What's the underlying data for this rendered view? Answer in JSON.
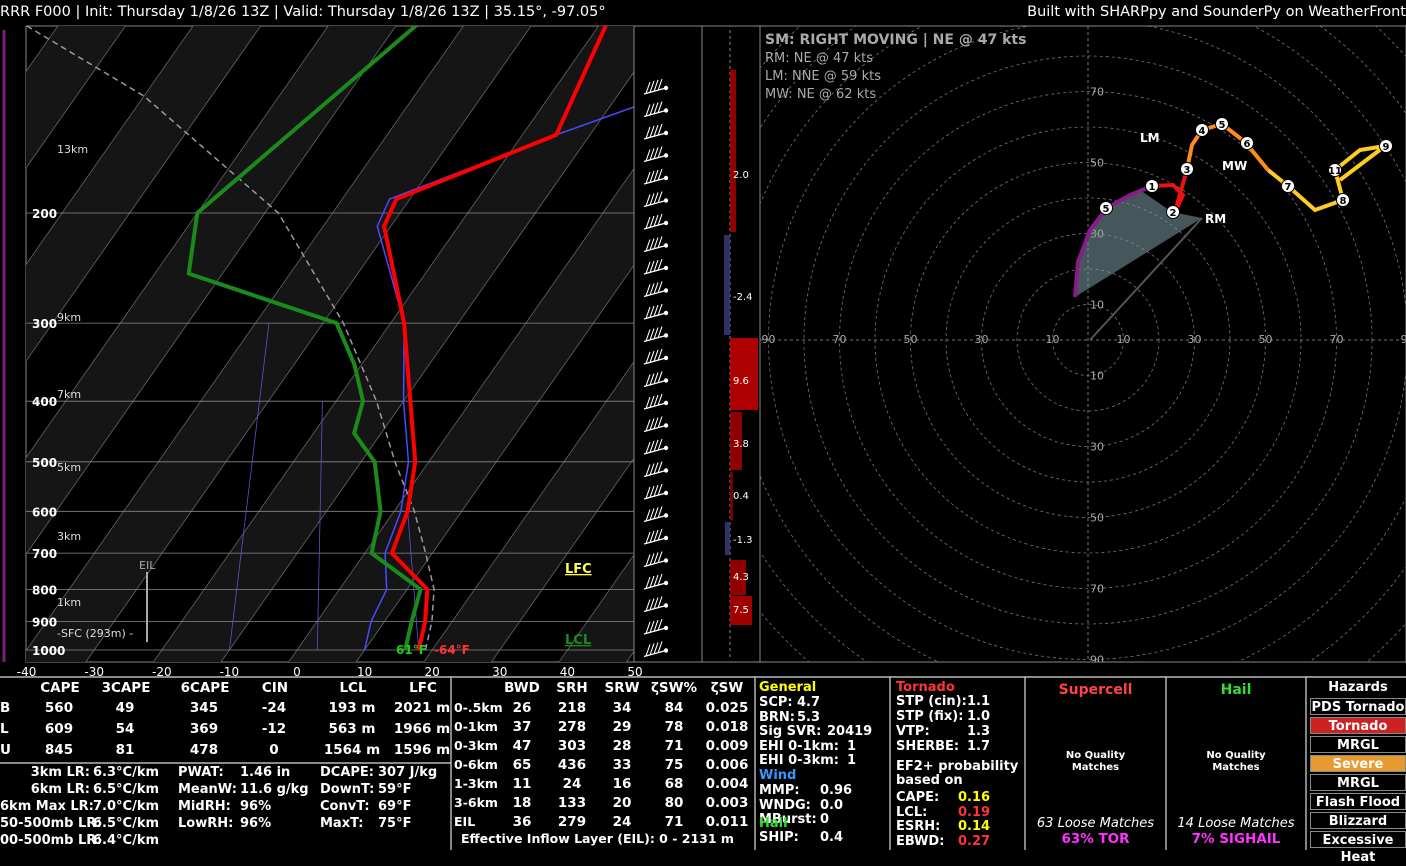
{
  "header": {
    "left": "RRR F000 | Init: Thursday 1/8/26 13Z | Valid: Thursday 1/8/26 13Z | 35.15°, -97.05°",
    "right": "Built with SHARPpy and SounderPy on WeatherFront"
  },
  "colors": {
    "temp": "#ff0000",
    "dew": "#1a8a1a",
    "parcel": "#999999",
    "virtual": "#4a4aff",
    "storm_text": "#aaaaaa"
  },
  "chart_data": [
    {
      "type": "line",
      "title": "Skew-T",
      "x_ticks": [
        "-40",
        "-30",
        "-20",
        "-10",
        "0",
        "10",
        "20",
        "30",
        "40",
        "50"
      ],
      "pressure_ticks": [
        "200",
        "300",
        "400",
        "500",
        "600",
        "700",
        "800",
        "900",
        "1000"
      ],
      "height_labels": [
        "13km",
        "9km",
        "7km",
        "5km",
        "3km",
        "1km",
        "-SFC (293m) -"
      ],
      "series": [
        {
          "name": "temperature",
          "points": [
            [
              -19,
              100
            ],
            [
              -15,
              150
            ],
            [
              -32,
              190
            ],
            [
              -31,
              210
            ],
            [
              -18,
              300
            ],
            [
              -9,
              400
            ],
            [
              -2,
              500
            ],
            [
              2,
              600
            ],
            [
              4,
              700
            ],
            [
              13,
              800
            ],
            [
              16,
              900
            ],
            [
              18,
              1000
            ]
          ]
        },
        {
          "name": "dewpoint",
          "points": [
            [
              -47,
              100
            ],
            [
              -60,
              200
            ],
            [
              -55,
              250
            ],
            [
              -28,
              300
            ],
            [
              -21,
              350
            ],
            [
              -16,
              400
            ],
            [
              -14,
              450
            ],
            [
              -8,
              500
            ],
            [
              -2,
              600
            ],
            [
              1,
              700
            ],
            [
              12,
              800
            ],
            [
              14,
              900
            ],
            [
              16,
              1000
            ]
          ]
        }
      ],
      "surface_temp": "-64°F",
      "surface_dew": "61°F",
      "annotations": [
        "LFC",
        "LCL",
        "EIL"
      ]
    },
    {
      "type": "bar",
      "title": "SRW",
      "labels": [
        "2.0",
        "-2.4",
        "9.6",
        "3.8",
        "0.4",
        "-1.3",
        "4.3",
        "7.5"
      ]
    },
    {
      "type": "line",
      "title": "Hodograph",
      "ring_labels": [
        "10",
        "30",
        "50",
        "70",
        "90"
      ],
      "height_markers": [
        "1",
        "2",
        "3",
        "4",
        "5",
        "6",
        "7",
        "8",
        "9",
        "11",
        "5"
      ],
      "vectors": [
        "RM",
        "LM",
        "MW"
      ],
      "storm_motion": {
        "sm": "SM: RIGHT MOVING | NE @ 47 kts",
        "rm": "RM: NE @ 47 kts",
        "lm": "LM: NNE @ 59 kts",
        "mw": "MW: NE @ 62 kts"
      }
    }
  ],
  "thermo_table": {
    "headers": [
      "CAPE",
      "3CAPE",
      "6CAPE",
      "CIN",
      "LCL",
      "LFC"
    ],
    "rows": [
      [
        "B",
        "560",
        "49",
        "345",
        "-24",
        "193 m",
        "2021 m"
      ],
      [
        "L",
        "609",
        "54",
        "369",
        "-12",
        "563 m",
        "1966 m"
      ],
      [
        "U",
        "845",
        "81",
        "478",
        "0",
        "1564 m",
        "1596 m"
      ]
    ]
  },
  "lapse": [
    [
      "3km LR:",
      "6.3°C/km"
    ],
    [
      "6km LR:",
      "6.5°C/km"
    ],
    [
      "6km Max LR:",
      "7.0°C/km"
    ],
    [
      "50-500mb LR:",
      "6.5°C/km"
    ],
    [
      "00-500mb LR:",
      "6.4°C/km"
    ]
  ],
  "moisture": [
    [
      "PWAT:",
      "1.46 in"
    ],
    [
      "MeanW:",
      "11.6 g/kg"
    ],
    [
      "MidRH:",
      "96%"
    ],
    [
      "LowRH:",
      "96%"
    ]
  ],
  "misc": [
    [
      "DCAPE:",
      "307 J/kg"
    ],
    [
      "DownT:",
      "59°F"
    ],
    [
      "ConvT:",
      "69°F"
    ],
    [
      "MaxT:",
      "75°F"
    ]
  ],
  "kinematic": {
    "headers": [
      "BWD",
      "SRH",
      "SRW",
      "ζSW%",
      "ζSW"
    ],
    "rows": [
      [
        "0-.5km",
        "26",
        "218",
        "34",
        "84",
        "0.025"
      ],
      [
        "0-1km",
        "37",
        "278",
        "29",
        "78",
        "0.018"
      ],
      [
        "0-3km",
        "47",
        "303",
        "28",
        "71",
        "0.009"
      ],
      [
        "0-6km",
        "65",
        "436",
        "33",
        "75",
        "0.006"
      ],
      [
        "1-3km",
        "11",
        "24",
        "16",
        "68",
        "0.004"
      ],
      [
        "3-6km",
        "18",
        "133",
        "20",
        "80",
        "0.003"
      ],
      [
        "EIL",
        "36",
        "279",
        "24",
        "71",
        "0.011"
      ]
    ],
    "footer": "Effective Inflow Layer (EIL): 0 - 2131 m"
  },
  "general": {
    "title": "General",
    "items": [
      [
        "SCP:",
        "4.7"
      ],
      [
        "BRN:",
        "5.3"
      ],
      [
        "Sig SVR:",
        "20419"
      ],
      [
        "EHI 0-1km:",
        "1"
      ],
      [
        "EHI 0-3km:",
        "1"
      ]
    ],
    "wind_title": "Wind",
    "wind": [
      [
        "MMP:",
        "0.96"
      ],
      [
        "WNDG:",
        "0.0"
      ],
      [
        "MBurst:",
        "0"
      ]
    ],
    "hail_title": "Hail",
    "hail": [
      [
        "SHIP:",
        "0.4"
      ]
    ]
  },
  "tornado": {
    "title": "Tornado",
    "items": [
      [
        "STP (cin):",
        "1.1"
      ],
      [
        "STP (fix):",
        "1.0"
      ],
      [
        "VTP:",
        "1.3"
      ],
      [
        "SHERBE:",
        "1.7"
      ]
    ],
    "ef_title": "EF2+ probability based on",
    "ef": [
      [
        "CAPE:",
        "0.16"
      ],
      [
        "LCL:",
        "0.19"
      ],
      [
        "ESRH:",
        "0.14"
      ],
      [
        "EBWD:",
        "0.27"
      ]
    ]
  },
  "supercell": {
    "title": "Supercell",
    "quality": "No Quality Matches",
    "loose": "63 Loose Matches",
    "pct": "63% TOR"
  },
  "hail_box": {
    "title": "Hail",
    "quality": "No Quality Matches",
    "loose": "14 Loose Matches",
    "pct": "7% SIGHAIL"
  },
  "hazards": [
    "Hazards",
    "PDS Tornado",
    "Tornado",
    "MRGL Tornado",
    "Severe",
    "MRGL Severe",
    "Flash Flood",
    "Blizzard",
    "Excessive Heat"
  ]
}
